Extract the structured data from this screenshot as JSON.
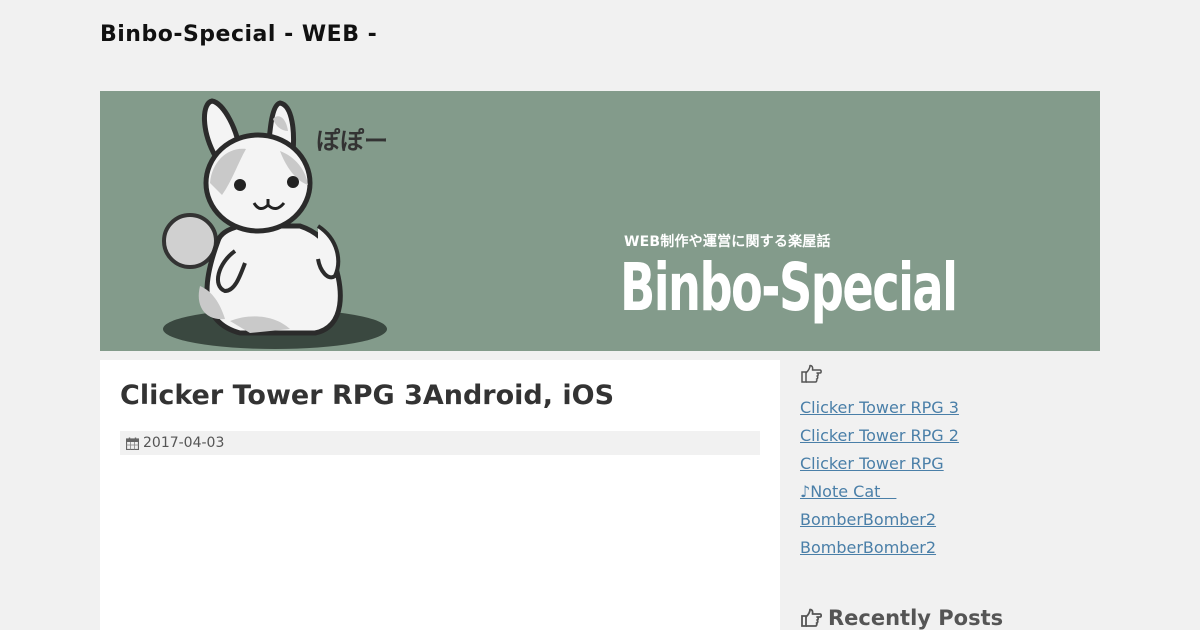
{
  "header": {
    "site_title": "Binbo-Special - WEB -"
  },
  "banner": {
    "voice": "ぽぽー",
    "tagline": "WEB制作や運営に関する楽屋話",
    "name": "Binbo-Special",
    "bg_color": "#839b8b"
  },
  "post": {
    "title": "Clicker Tower RPG 3Android, iOS",
    "date": "2017-04-03",
    "date_icon": "calendar-icon"
  },
  "sidebar": {
    "widget_icon": "hand-pointing-icon",
    "links": [
      {
        "label": "Clicker Tower RPG 3"
      },
      {
        "label": "Clicker Tower RPG 2"
      },
      {
        "label": "Clicker Tower RPG"
      },
      {
        "label": "♪Note Cat　"
      },
      {
        "label": "BomberBomber2"
      },
      {
        "label": "BomberBomber2"
      }
    ],
    "recent_title": "Recently Posts"
  },
  "colors": {
    "page_bg": "#f1f1f1",
    "link": "#4a7fa8"
  }
}
